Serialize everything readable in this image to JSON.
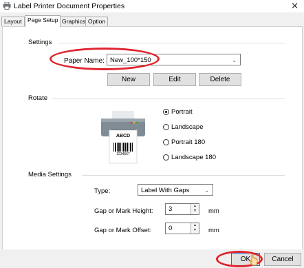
{
  "window": {
    "title": "Label Printer Document Properties",
    "close_glyph": "✕"
  },
  "tabs": [
    {
      "label": "Layout"
    },
    {
      "label": "Page Setup"
    },
    {
      "label": "Graphics"
    },
    {
      "label": "Option"
    }
  ],
  "settings": {
    "group_label": "Settings",
    "paper_name_label": "Paper Name:",
    "paper_name_value": "New_100*150",
    "new_button": "New",
    "edit_button": "Edit",
    "delete_button": "Delete"
  },
  "rotate": {
    "group_label": "Rotate",
    "label_text": "ABCD",
    "barcode_number": "1234567",
    "options": [
      {
        "label": "Portrait",
        "selected": true
      },
      {
        "label": "Landscape",
        "selected": false
      },
      {
        "label": "Portrait 180",
        "selected": false
      },
      {
        "label": "Landscape 180",
        "selected": false
      }
    ]
  },
  "media": {
    "group_label": "Media Settings",
    "type_label": "Type:",
    "type_value": "Label With Gaps",
    "gap_label": "Gap or Mark Height:",
    "gap_value": "3",
    "gap_unit": "mm",
    "offset_label": "Gap or Mark Offset:",
    "offset_value": "0",
    "offset_unit": "mm"
  },
  "footer": {
    "ok_button": "OK",
    "cancel_button": "Cancel"
  },
  "colors": {
    "highlight": "#e0242f",
    "printer_body": "#7f8c96",
    "printer_light": "#dfe3e6"
  }
}
